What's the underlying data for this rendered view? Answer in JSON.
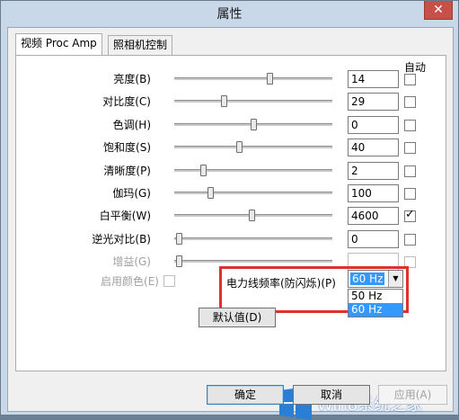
{
  "window": {
    "title": "属性",
    "close_glyph": "✕"
  },
  "tabs": [
    {
      "label": "视频 Proc Amp",
      "active": true
    },
    {
      "label": "照相机控制",
      "active": false
    }
  ],
  "auto_header": "自动",
  "sliders": [
    {
      "label": "亮度(B)",
      "value": "14",
      "fraction": 0.61,
      "auto": false,
      "disabled": false
    },
    {
      "label": "对比度(C)",
      "value": "29",
      "fraction": 0.31,
      "auto": false,
      "disabled": false
    },
    {
      "label": "色调(H)",
      "value": "0",
      "fraction": 0.5,
      "auto": false,
      "disabled": false
    },
    {
      "label": "饱和度(S)",
      "value": "40",
      "fraction": 0.41,
      "auto": false,
      "disabled": false
    },
    {
      "label": "清晰度(P)",
      "value": "2",
      "fraction": 0.17,
      "auto": false,
      "disabled": false
    },
    {
      "label": "伽玛(G)",
      "value": "100",
      "fraction": 0.22,
      "auto": false,
      "disabled": false
    },
    {
      "label": "白平衡(W)",
      "value": "4600",
      "fraction": 0.49,
      "auto": true,
      "disabled": false
    },
    {
      "label": "逆光对比(B)",
      "value": "0",
      "fraction": 0.01,
      "auto": false,
      "disabled": false
    },
    {
      "label": "增益(G)",
      "value": "",
      "fraction": 0.01,
      "auto": false,
      "disabled": true
    }
  ],
  "color_enable": {
    "label": "启用颜色(E)",
    "checked": false,
    "disabled": true
  },
  "powerline": {
    "label": "电力线频率(防闪烁)(P)",
    "selected": "60 Hz",
    "options": [
      "50 Hz",
      "60 Hz"
    ],
    "highlighted": "60 Hz"
  },
  "buttons": {
    "defaults": "默认值(D)",
    "ok": "确定",
    "cancel": "取消",
    "apply": "应用(A)"
  },
  "watermark": {
    "text": "Win8系统之家"
  },
  "colors": {
    "accent": "#3399ff",
    "highlight_box": "#e0302b",
    "titlebar": "#c9d8e8"
  }
}
